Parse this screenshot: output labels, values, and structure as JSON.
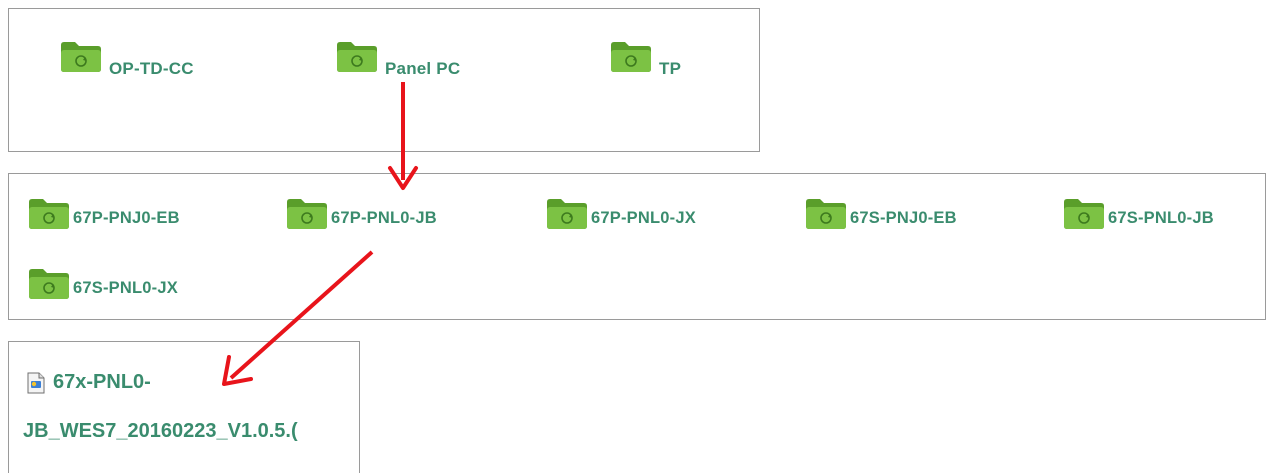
{
  "colors": {
    "label": "#3a8c6e",
    "folder_body": "#7cc244",
    "folder_dark": "#5a9e2a",
    "arrow": "#e8141b",
    "border": "#9a9a9a"
  },
  "icons": {
    "folder": "folder-icon",
    "file": "file-icon"
  },
  "level1": {
    "folders": [
      {
        "label": "OP-TD-CC"
      },
      {
        "label": "Panel PC"
      },
      {
        "label": "TP"
      }
    ]
  },
  "level2": {
    "folders": [
      {
        "label": "67P-PNJ0-EB"
      },
      {
        "label": "67P-PNL0-JB"
      },
      {
        "label": "67P-PNL0-JX"
      },
      {
        "label": "67S-PNJ0-EB"
      },
      {
        "label": "67S-PNL0-JB"
      },
      {
        "label": "67S-PNL0-JX"
      }
    ]
  },
  "level3": {
    "file": {
      "line1": "67x-PNL0-",
      "line2": "JB_WES7_20160223_V1.0.5.("
    }
  }
}
